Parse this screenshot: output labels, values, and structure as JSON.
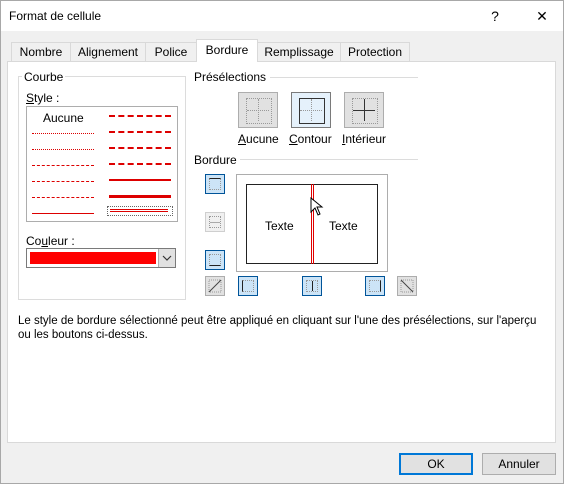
{
  "window": {
    "title": "Format de cellule",
    "help_label": "?",
    "close_label": "✕"
  },
  "tabs": [
    {
      "label": "Nombre"
    },
    {
      "label": "Alignement"
    },
    {
      "label": "Police"
    },
    {
      "label": "Bordure"
    },
    {
      "label": "Remplissage"
    },
    {
      "label": "Protection"
    }
  ],
  "active_tab": "Bordure",
  "courbe": {
    "group_label": "Courbe",
    "style_label_first": "S",
    "style_label_rest": "tyle :",
    "none_label": "Aucune",
    "color_label_pre": "Co",
    "color_label_u": "u",
    "color_label_post": "leur :",
    "color_value": "#ff0000"
  },
  "presets": {
    "group_label": "Présélections",
    "items": [
      {
        "label_u": "A",
        "label_rest": "ucune"
      },
      {
        "label_u": "C",
        "label_rest": "ontour"
      },
      {
        "label_u": "I",
        "label_rest": "ntérieur"
      }
    ]
  },
  "border": {
    "group_label": "Bordure",
    "preview_left_text": "Texte",
    "preview_right_text": "Texte",
    "active_color": "#e00000"
  },
  "hint_text": "Le style de bordure sélectionné peut être appliqué en cliquant sur l'une des présélections, sur l'aperçu ou les boutons ci-dessus.",
  "footer": {
    "ok_label": "OK",
    "cancel_label": "Annuler"
  }
}
